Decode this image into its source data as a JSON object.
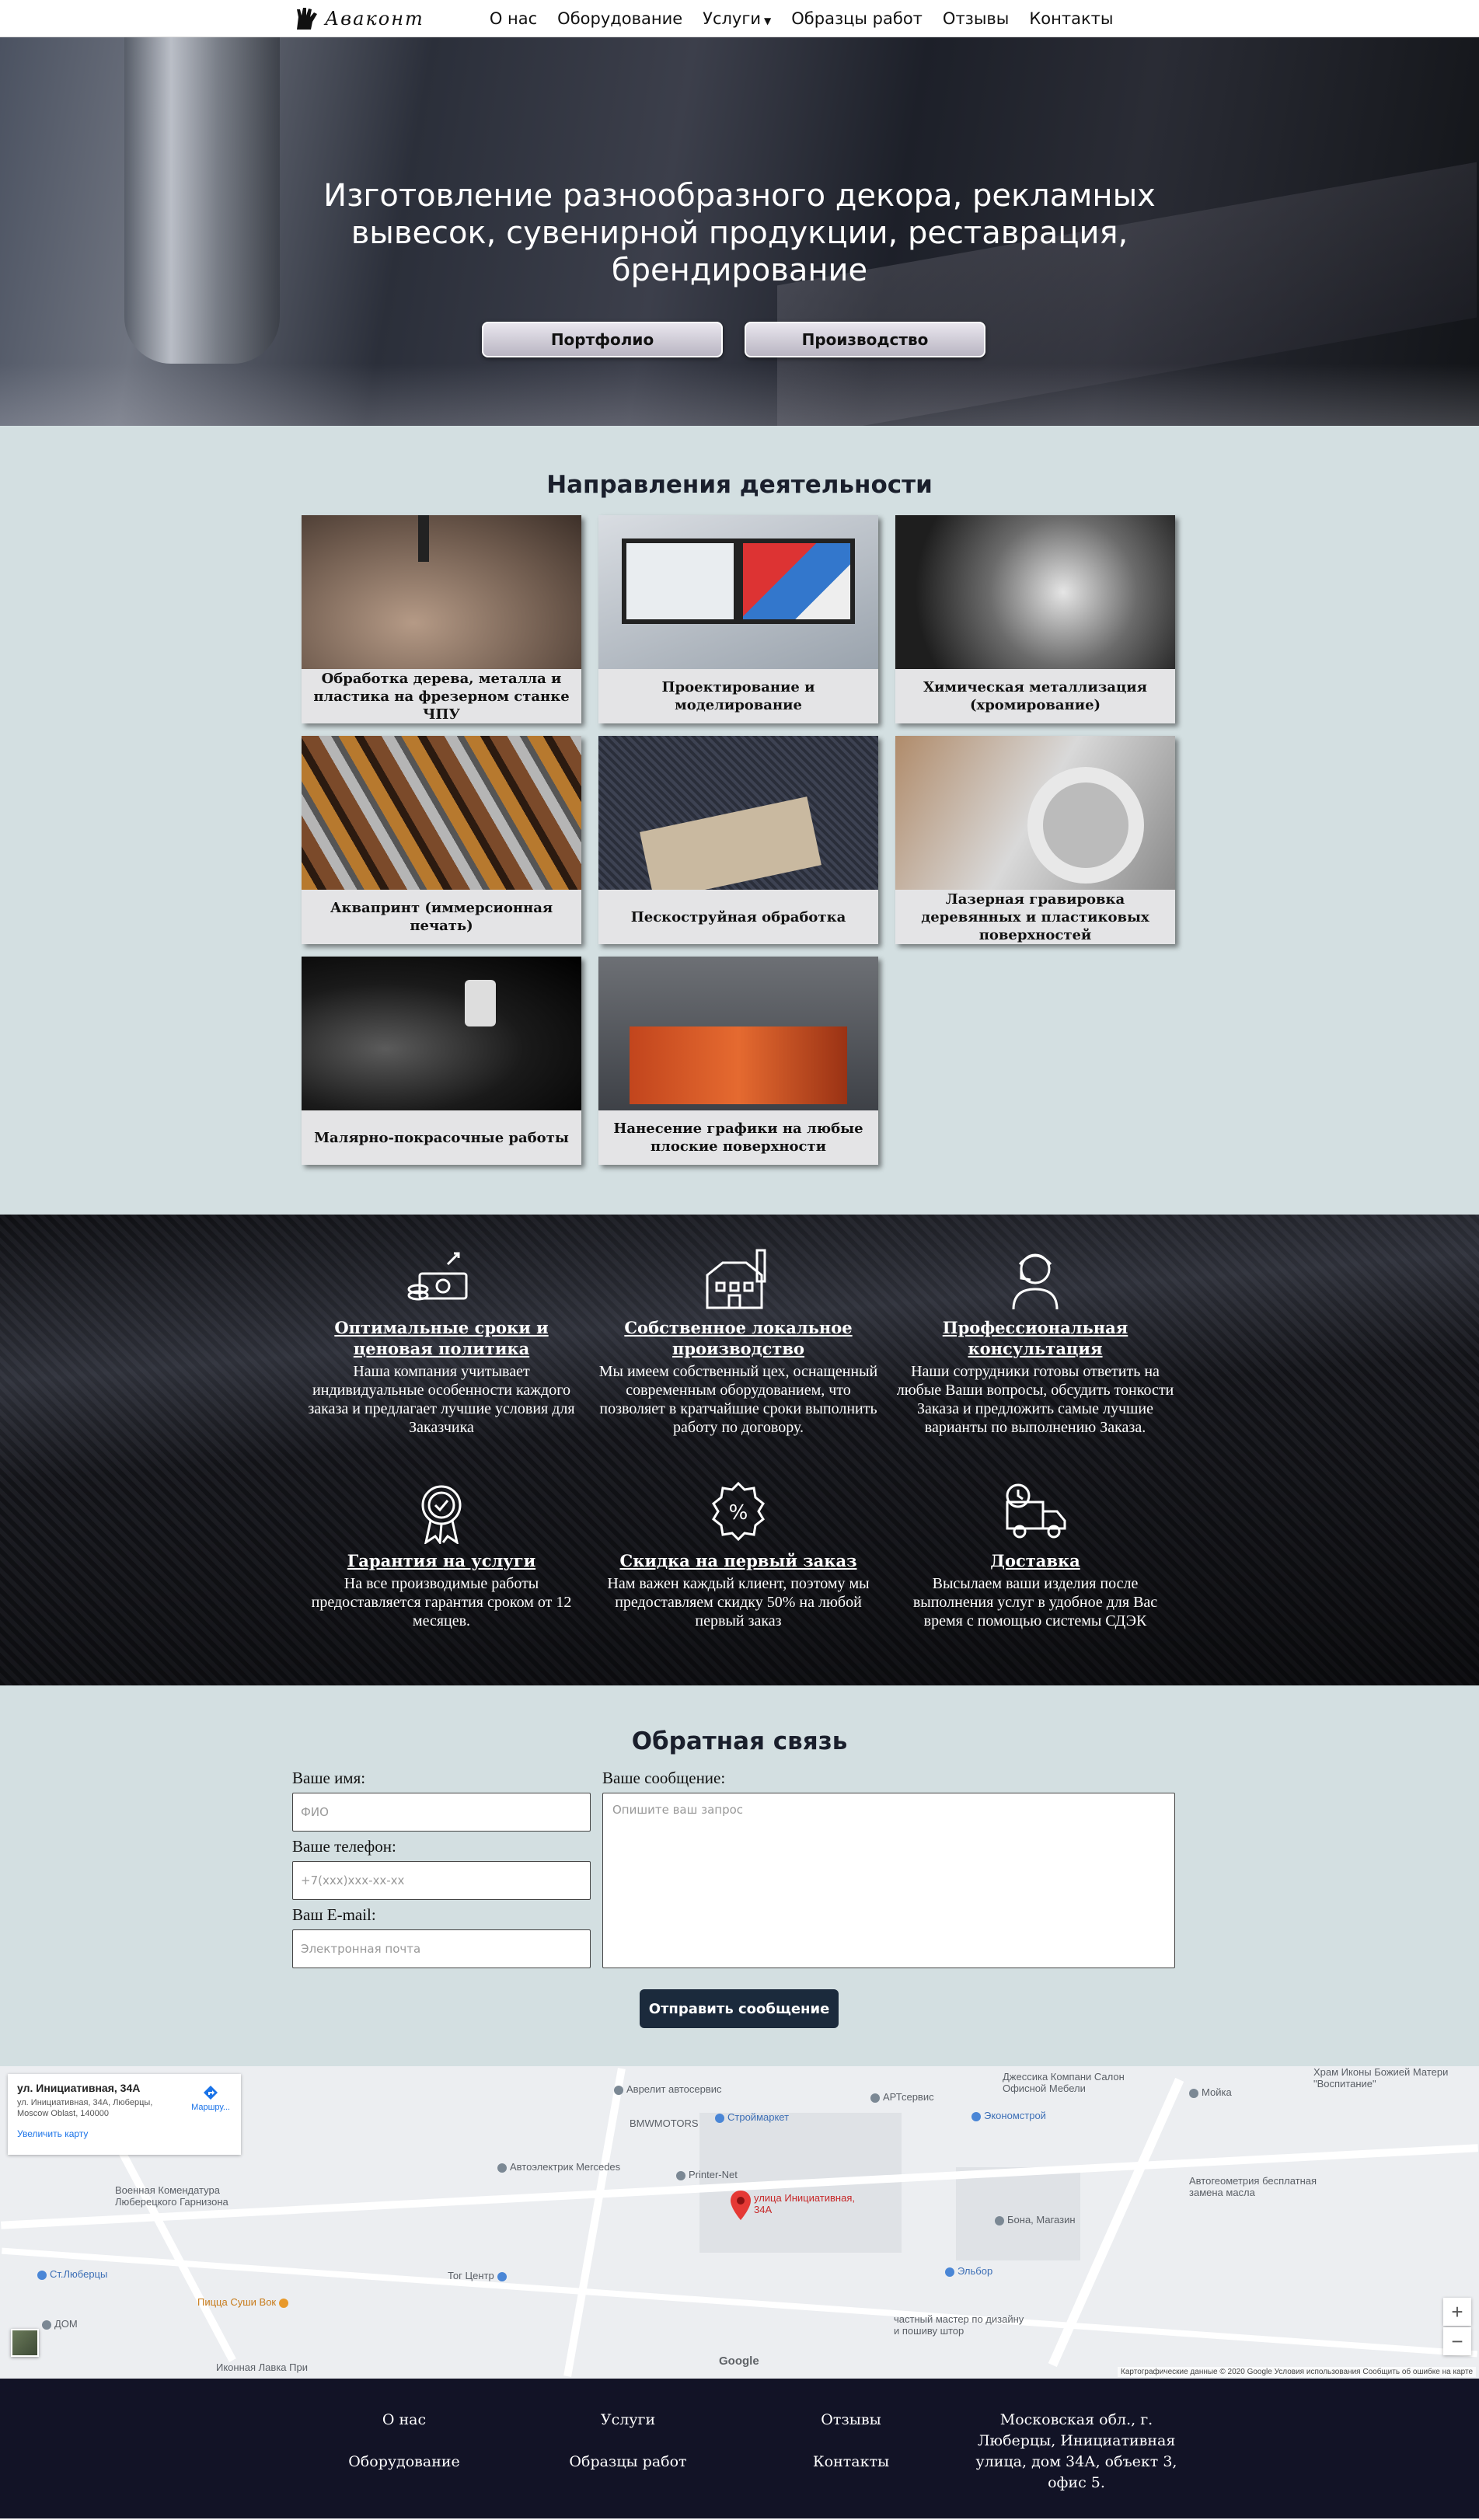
{
  "nav": {
    "logo_text": "Аваконт",
    "items": [
      "О нас",
      "Оборудование",
      "Услуги",
      "Образцы работ",
      "Отзывы",
      "Контакты"
    ]
  },
  "hero": {
    "title": "Изготовление разнообразного декора, рекламных вывесок, сувенирной продукции, реставрация, брендирование",
    "btn_portfolio": "Портфолио",
    "btn_production": "Производство"
  },
  "directions": {
    "title": "Направления деятельности",
    "cards": [
      {
        "caption": "Обработка дерева, металла и пластика на фрезерном станке ЧПУ"
      },
      {
        "caption": "Проектирование и моделирование"
      },
      {
        "caption": "Химическая металлизация (хромирование)"
      },
      {
        "caption": "Аквапринт (иммерсионная печать)"
      },
      {
        "caption": "Пескоструйная обработка"
      },
      {
        "caption": "Лазерная гравировка деревянных и пластиковых поверхностей"
      },
      {
        "caption": "Малярно-покрасочные работы"
      },
      {
        "caption": "Нанесение графики на любые плоские поверхности"
      }
    ]
  },
  "advantages": [
    {
      "icon": "money-icon",
      "title": "Оптимальные сроки и ценовая политика",
      "text": "Наша компания учитывает индивидуальные особенности каждого заказа и предлагает лучшие условия для Заказчика"
    },
    {
      "icon": "factory-icon",
      "title": "Собственное локальное производство",
      "text": "Мы имеем собственный цех, оснащенный современным оборудованием, что позволяет в кратчайшие сроки выполнить работу по договору."
    },
    {
      "icon": "consultant-icon",
      "title": "Профессиональная консультация",
      "text": "Наши сотрудники готовы ответить на любые Ваши вопросы, обсудить тонкости Заказа и предложить самые лучшие варианты по выполнению Заказа."
    },
    {
      "icon": "award-icon",
      "title": "Гарантия на услуги",
      "text": "На все производимые работы предоставляется гарантия сроком от 12 месяцев."
    },
    {
      "icon": "discount-icon",
      "title": "Скидка на первый заказ",
      "text": "Нам важен каждый клиент, поэтому мы предоставляем скидку 50% на любой первый заказ"
    },
    {
      "icon": "delivery-truck-icon",
      "title": "Доставка",
      "text": "Высылаем ваши изделия после выполнения услуг в удобное для Вас время с помощью системы СДЭК"
    }
  ],
  "feedback": {
    "title": "Обратная связь",
    "name_label": "Ваше имя:",
    "name_placeholder": "ФИО",
    "phone_label": "Ваше телефон:",
    "phone_placeholder": "+7(xxx)xxx-xx-xx",
    "email_label": "Ваш E-mail:",
    "email_placeholder": "Электронная почта",
    "message_label": "Ваше сообщение:",
    "message_placeholder": "Опишите ваш запрос",
    "submit": "Отправить сообщение"
  },
  "map": {
    "info_title": "ул. Инициативная, 34А",
    "info_address": "ул. Инициативная, 34А, Люберцы, Moscow Oblast, 140000",
    "info_route": "Маршру...",
    "info_enlarge": "Увеличить карту",
    "marker_label": "улица Инициативная, 34А",
    "pois": [
      "Аврелит автосервис",
      "Джессика Компани Салон Офисной Мебели",
      "АРТсервис",
      "BMWMOTORS",
      "Строймаркет",
      "Экономстрой",
      "Мойка",
      "Храм Иконы Божией Матери \"Воспитание\"",
      "Автоэлектрик Mercedes",
      "Printer-Net",
      "Военная Комендатура Люберецкого Гарнизона",
      "Автогеометрия бесплатная замена масла",
      "Бона, Магазин",
      "Ст.Люберцы",
      "Тог Центр",
      "Эльбор",
      "Пицца Суши Вок",
      "ДОМ",
      "частный мастер по дизайну и пошиву штор",
      "Иконная Лавка При"
    ],
    "footer_text": "Картографические данные © 2020 Google   Условия использования   Сообщить об ошибке на карте",
    "google": "Google",
    "zoom_in": "+",
    "zoom_out": "−"
  },
  "footer": {
    "links": [
      "О нас",
      "Услуги",
      "Отзывы",
      "Оборудование",
      "Образцы работ",
      "Контакты"
    ],
    "address": "Московская обл., г. Люберцы, Инициативная улица, дом 34А, объект 3, офис 5."
  }
}
